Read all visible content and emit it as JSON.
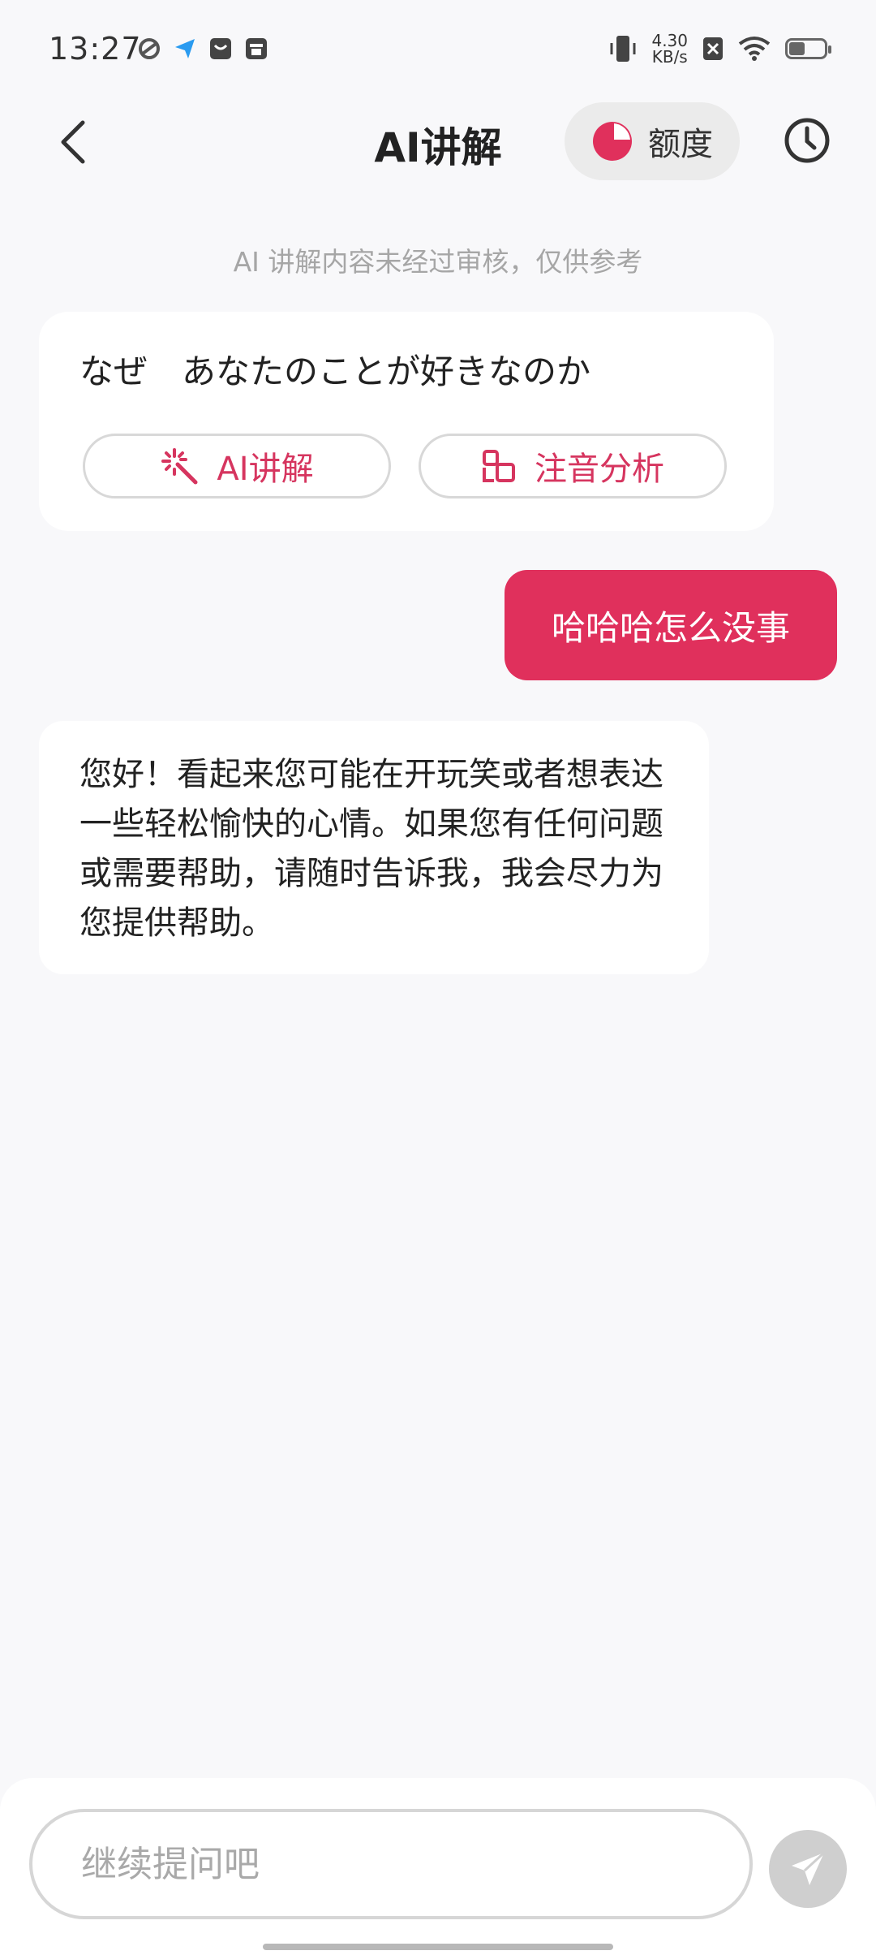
{
  "status_bar": {
    "time": "13:27",
    "net_speed_value": "4.30",
    "net_speed_unit": "KB/s",
    "battery_level": 0.45
  },
  "header": {
    "title": "AI讲解",
    "quota_label": "额度"
  },
  "disclaimer": "AI 讲解内容未经过审核，仅供参考",
  "card": {
    "sentence": "なぜ　あなたのことが好きなのか",
    "ai_explain_label": "AI讲解",
    "phonetic_label": "注音分析"
  },
  "messages": {
    "user": "哈哈哈怎么没事",
    "ai": "您好！看起来您可能在开玩笑或者想表达一些轻松愉快的心情。如果您有任何问题或需要帮助，请随时告诉我，我会尽力为您提供帮助。"
  },
  "input": {
    "placeholder": "继续提问吧"
  },
  "colors": {
    "accent": "#e0305c",
    "accent_text": "#d6355f"
  },
  "icons": {
    "back": "chevron-left-icon",
    "quota": "pie-chart-icon",
    "history": "clock-icon",
    "ai_explain": "sparkle-wand-icon",
    "phonetic": "component-icon",
    "send": "paper-plane-icon"
  }
}
